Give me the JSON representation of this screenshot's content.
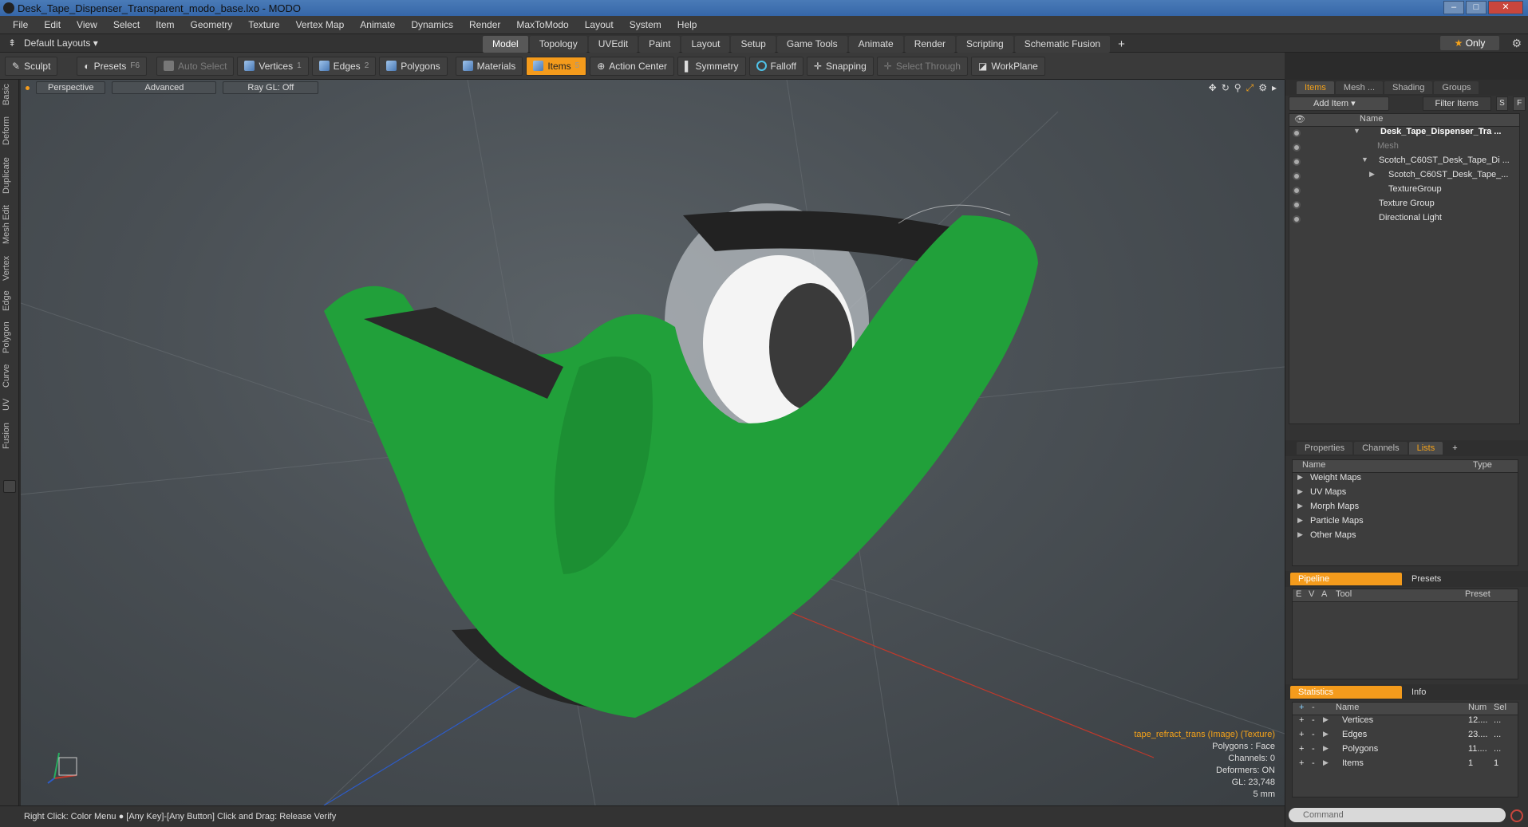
{
  "window": {
    "title": "Desk_Tape_Dispenser_Transparent_modo_base.lxo - MODO"
  },
  "menu": [
    "File",
    "Edit",
    "View",
    "Select",
    "Item",
    "Geometry",
    "Texture",
    "Vertex Map",
    "Animate",
    "Dynamics",
    "Render",
    "MaxToModo",
    "Layout",
    "System",
    "Help"
  ],
  "layout": {
    "dropdown": "Default Layouts",
    "tabs": [
      "Model",
      "Topology",
      "UVEdit",
      "Paint",
      "Layout",
      "Setup",
      "Game Tools",
      "Animate",
      "Render",
      "Scripting",
      "Schematic Fusion"
    ],
    "active_tab": "Model",
    "only_label": "Only"
  },
  "toolbar": {
    "sculpt": "Sculpt",
    "presets": "Presets",
    "presets_key": "F6",
    "auto_select": "Auto Select",
    "vertices": "Vertices",
    "vertices_key": "1",
    "edges": "Edges",
    "edges_key": "2",
    "polygons": "Polygons",
    "materials": "Materials",
    "items": "Items",
    "items_key": "5",
    "action_center": "Action Center",
    "symmetry": "Symmetry",
    "falloff": "Falloff",
    "snapping": "Snapping",
    "select_through": "Select Through",
    "workplane": "WorkPlane"
  },
  "left_tabs": [
    "Basic",
    "Deform",
    "Duplicate",
    "Mesh Edit",
    "Vertex",
    "Edge",
    "Polygon",
    "Curve",
    "UV",
    "Fusion"
  ],
  "viewport": {
    "perspective": "Perspective",
    "advanced": "Advanced",
    "raygl": "Ray GL: Off",
    "info": {
      "texture": "tape_refract_trans (Image) (Texture)",
      "polygons": "Polygons : Face",
      "channels": "Channels: 0",
      "deformers": "Deformers: ON",
      "gl": "GL: 23,748",
      "scale": "5 mm"
    }
  },
  "status": {
    "text": "Right Click: Color Menu ● [Any Key]-[Any Button] Click and Drag: Release Verify"
  },
  "items_panel": {
    "tabs": [
      "Items",
      "Mesh ...",
      "Shading",
      "Groups"
    ],
    "add_item": "Add Item",
    "filter": "Filter Items",
    "s_btn": "S",
    "f_btn": "F",
    "name_header": "Name",
    "rows": [
      "Desk_Tape_Dispenser_Tra ...",
      "Mesh",
      "Scotch_C60ST_Desk_Tape_Di ...",
      "Scotch_C60ST_Desk_Tape_...",
      "TextureGroup",
      "Texture Group",
      "Directional Light"
    ]
  },
  "props_panel": {
    "tabs": [
      "Properties",
      "Channels",
      "Lists"
    ],
    "name_header": "Name",
    "type_header": "Type",
    "rows": [
      "Weight Maps",
      "UV Maps",
      "Morph Maps",
      "Particle Maps",
      "Other Maps"
    ]
  },
  "pipeline_panel": {
    "tabs": [
      "Pipeline",
      "Presets"
    ],
    "headers": {
      "e": "E",
      "v": "V",
      "a": "A",
      "tool": "Tool",
      "preset": "Preset"
    }
  },
  "stats_panel": {
    "tabs": [
      "Statistics",
      "Info"
    ],
    "headers": {
      "name": "Name",
      "num": "Num",
      "sel": "Sel"
    },
    "rows": [
      {
        "name": "Vertices",
        "num": "12....",
        "sel": "..."
      },
      {
        "name": "Edges",
        "num": "23....",
        "sel": "..."
      },
      {
        "name": "Polygons",
        "num": "11....",
        "sel": "..."
      },
      {
        "name": "Items",
        "num": "1",
        "sel": "1"
      }
    ]
  },
  "command": {
    "placeholder": "Command"
  }
}
